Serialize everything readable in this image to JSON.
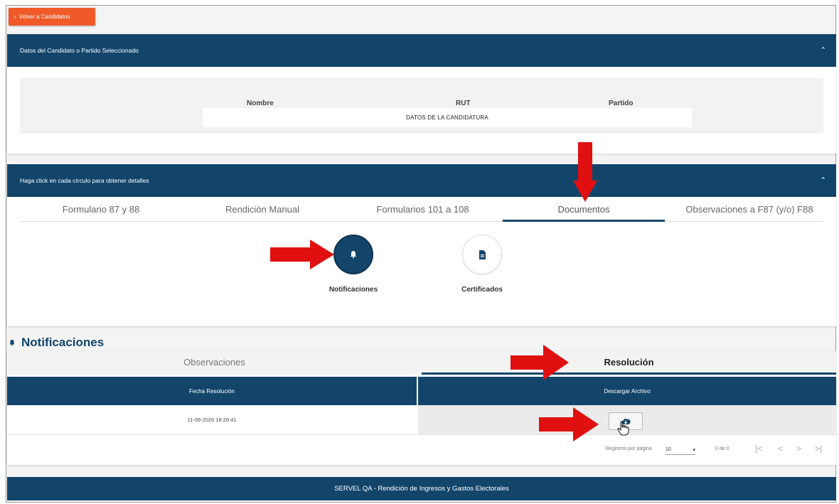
{
  "back_button": {
    "label": "Volver a Candidatos"
  },
  "candidate_section": {
    "title": "Datos del Candidato o Partido Seleccionado",
    "col_nombre": "Nombre",
    "col_rut": "RUT",
    "col_partido": "Partido",
    "value": "DATOS DE LA CANDIDATURA"
  },
  "details_section": {
    "title": "Haga click en cada círculo para obtener detalles",
    "tabs": [
      {
        "label": "Formulario 87 y 88"
      },
      {
        "label": "Rendición Manual"
      },
      {
        "label": "Formularios 101 a 108"
      },
      {
        "label": "Documentos"
      },
      {
        "label": "Observaciones a F87 (y/o) F88"
      }
    ],
    "active_tab": "Documentos",
    "circles": [
      {
        "label": "Notificaciones",
        "icon": "bell-icon"
      },
      {
        "label": "Certificados",
        "icon": "document-icon"
      }
    ]
  },
  "notifications": {
    "title": "Notificaciones",
    "subtabs": [
      {
        "label": "Observaciones"
      },
      {
        "label": "Resolución"
      }
    ],
    "active_subtab": "Resolución",
    "table": {
      "headers": [
        "Fecha Resolución",
        "Descargar Archivo"
      ],
      "rows": [
        {
          "fecha": "11-09-2020 18:20:41",
          "download_icon": "download-icon"
        }
      ]
    },
    "pagination": {
      "rows_per_page_label": "Registros por página",
      "rows_per_page": "10",
      "range": "0 de 0"
    }
  },
  "footer": {
    "text": "SERVEL QA - Rendición de Ingresos y Gastos Electorales"
  },
  "colors": {
    "primary": "#13456b",
    "accent": "#f05a28",
    "annotation_arrow": "#e01010"
  }
}
